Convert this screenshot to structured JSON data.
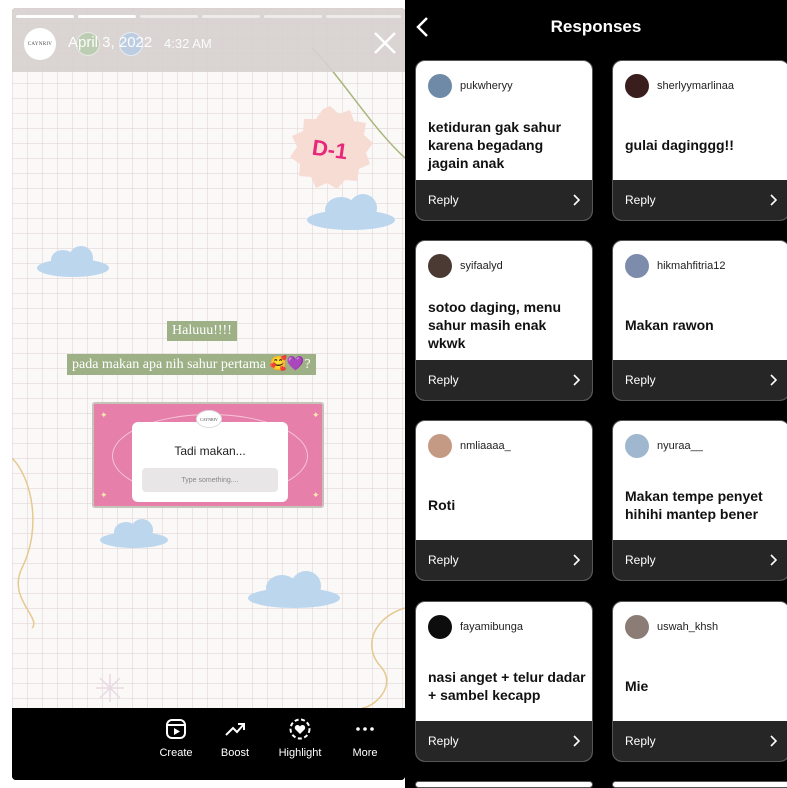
{
  "story": {
    "account_avatar_text": "CAYNRIV",
    "date": "April 3, 2022",
    "time": "4:32 AM",
    "sticker_day": "D-1",
    "greeting": "Haluuu!!!!",
    "question_line": "pada makan apa nih sahur pertama 🥰💜?",
    "question_badge": "CAYNRIV",
    "question_prompt": "Tadi makan...",
    "question_placeholder": "Type something....",
    "toolbar": [
      {
        "label": "Create",
        "icon": "reels-create-icon"
      },
      {
        "label": "Boost",
        "icon": "trending-arrow-icon"
      },
      {
        "label": "Highlight",
        "icon": "highlight-heart-icon"
      },
      {
        "label": "More",
        "icon": "more-dots-icon"
      }
    ]
  },
  "responses": {
    "title": "Responses",
    "reply_label": "Reply",
    "items": [
      {
        "username": "pukwheryy",
        "text": "ketiduran gak sahur karena begadang jagain anak",
        "avatar_color": "#6e8aa6"
      },
      {
        "username": "sherlyymarlinaa",
        "text": "gulai daginggg!!",
        "avatar_color": "#3a1d1d"
      },
      {
        "username": "syifaalyd",
        "text": "sotoo daging, menu sahur masih enak wkwk",
        "avatar_color": "#4a3a33"
      },
      {
        "username": "hikmahfitria12",
        "text": "Makan rawon",
        "avatar_color": "#7d8cab"
      },
      {
        "username": "nmliaaaa_",
        "text": "Roti",
        "avatar_color": "#c49a84"
      },
      {
        "username": "nyuraa__",
        "text": "Makan tempe penyet hihihi mantep bener",
        "avatar_color": "#9fb8cf"
      },
      {
        "username": "fayamibunga",
        "text": "nasi anget + telur dadar + sambel kecapp",
        "avatar_color": "#0d0d0d"
      },
      {
        "username": "uswah_khsh",
        "text": "Mie",
        "avatar_color": "#8b7d75"
      }
    ]
  },
  "colors": {
    "question_card_pink": "#e67fa9",
    "sticker_green": "#9db086",
    "reply_bar": "#262626"
  }
}
